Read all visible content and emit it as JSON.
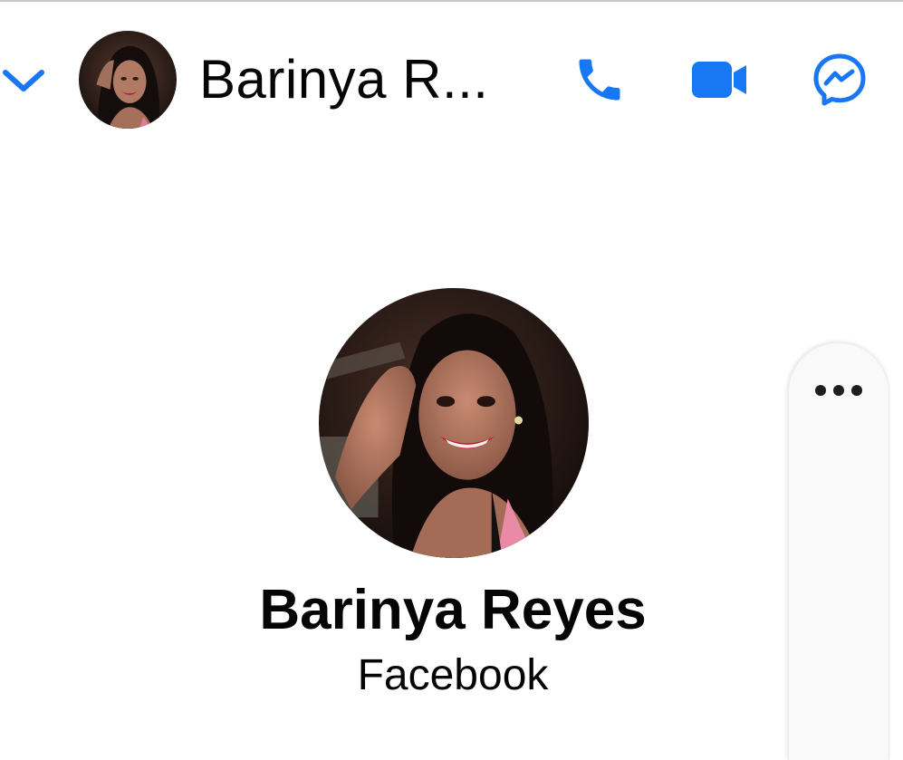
{
  "header": {
    "title": "Barinya R...",
    "icons": {
      "back": "chevron-down-icon",
      "call": "phone-icon",
      "video": "video-camera-icon",
      "messenger": "messenger-icon"
    },
    "accent_color": "#1877f2"
  },
  "profile": {
    "name": "Barinya Reyes",
    "subtitle": "Facebook"
  },
  "side_panel": {
    "more_icon": "more-dots-icon"
  }
}
